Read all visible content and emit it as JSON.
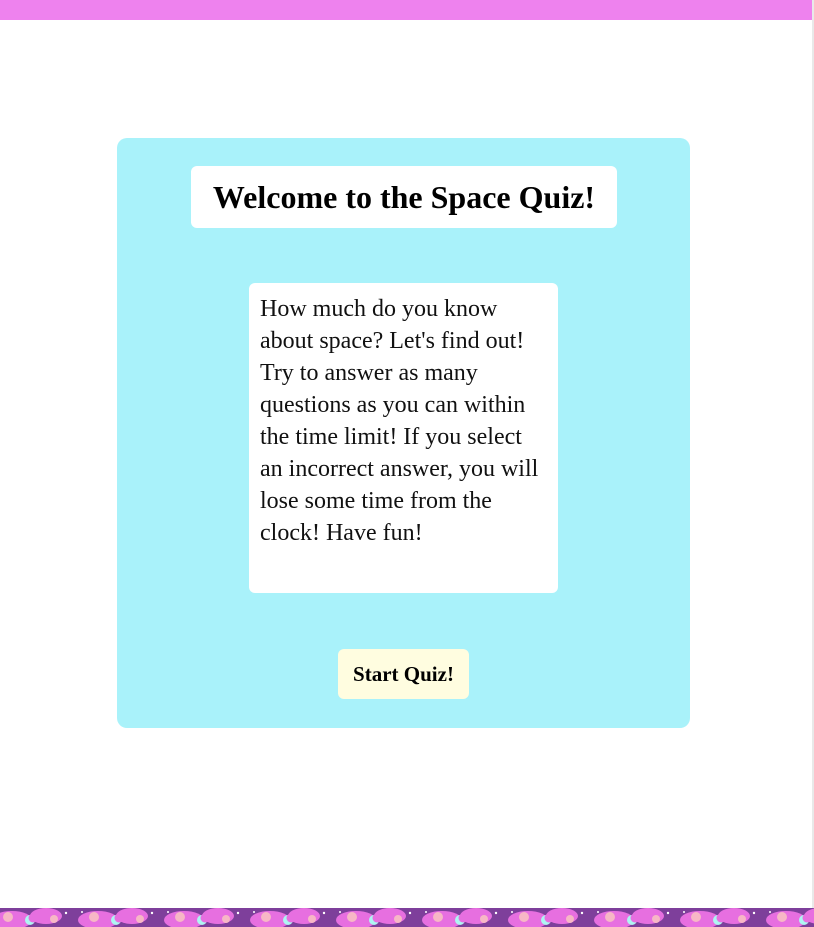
{
  "colors": {
    "top_bar": "#ee82ee",
    "card_background": "#a9f2fa",
    "button_background": "#fffde0",
    "footer_base": "#7e3f9b",
    "footer_cloud": "#e76fe0",
    "footer_moon": "#aef5f2",
    "footer_planet": "#f7b7c6"
  },
  "quiz": {
    "title": "Welcome to the Space Quiz!",
    "description": "How much do you know about space? Let's find out! Try to answer as many questions as you can within the time limit! If you select an incorrect answer, you will lose some time from the clock! Have fun!",
    "start_button_label": "Start Quiz!"
  },
  "footer": {
    "pattern_icon": "space-pattern"
  }
}
